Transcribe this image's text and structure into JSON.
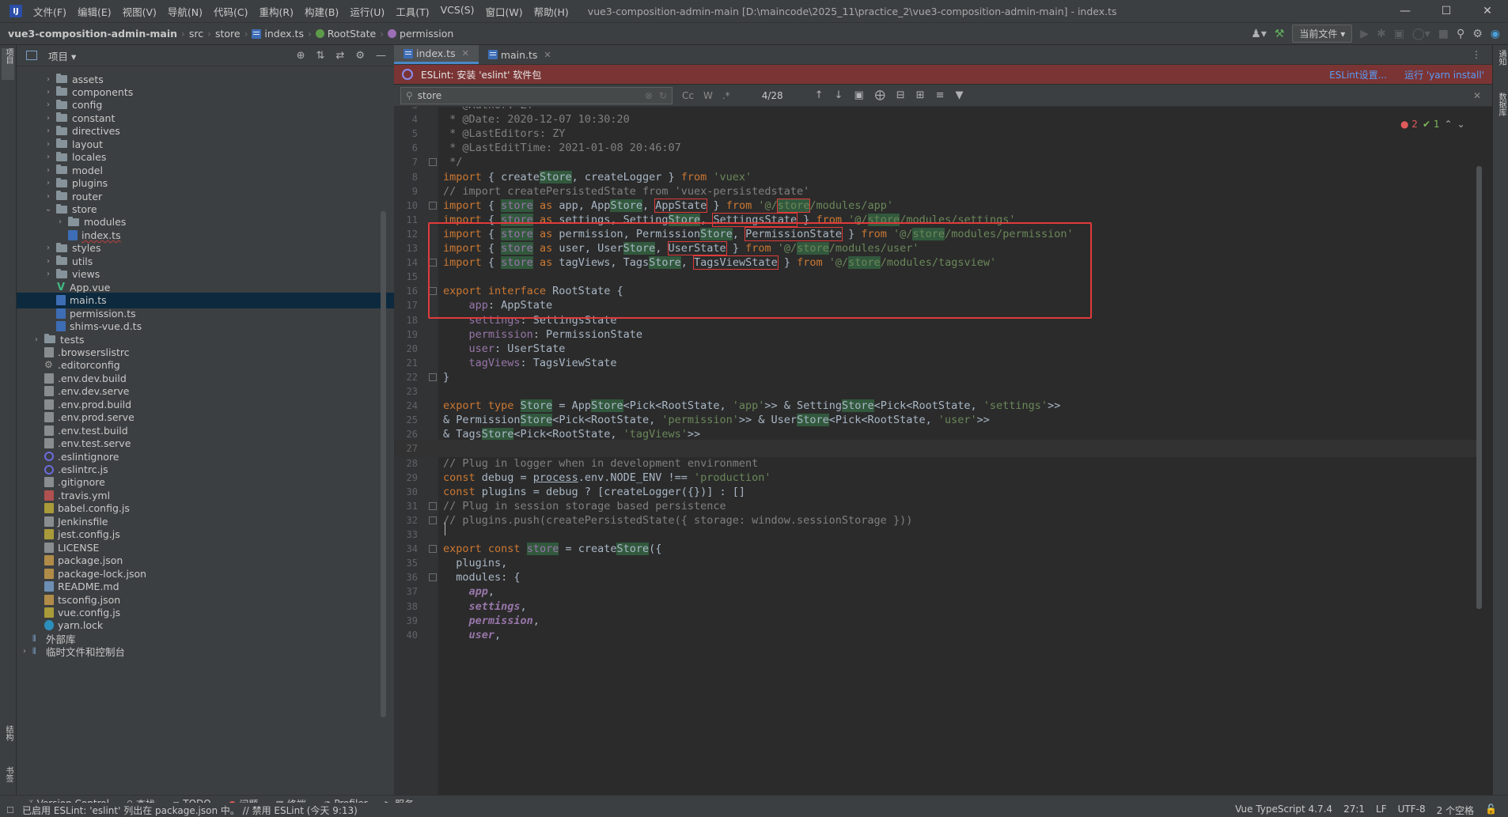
{
  "menubar": {
    "items": [
      "文件(F)",
      "编辑(E)",
      "视图(V)",
      "导航(N)",
      "代码(C)",
      "重构(R)",
      "构建(B)",
      "运行(U)",
      "工具(T)",
      "VCS(S)",
      "窗口(W)",
      "帮助(H)"
    ],
    "window_title": "vue3-composition-admin-main [D:\\maincode\\2025_11\\practice_2\\vue3-composition-admin-main] - index.ts"
  },
  "breadcrumb": [
    "vue3-composition-admin-main",
    "src",
    "store",
    "index.ts",
    "RootState",
    "permission"
  ],
  "toolbar": {
    "run_config": "当前文件"
  },
  "project_panel": {
    "title": "项目"
  },
  "tree": [
    {
      "label": "assets",
      "type": "folder",
      "depth": 1,
      "expanded": false
    },
    {
      "label": "components",
      "type": "folder",
      "depth": 1,
      "expanded": false
    },
    {
      "label": "config",
      "type": "folder",
      "depth": 1,
      "expanded": false
    },
    {
      "label": "constant",
      "type": "folder",
      "depth": 1,
      "expanded": false
    },
    {
      "label": "directives",
      "type": "folder",
      "depth": 1,
      "expanded": false
    },
    {
      "label": "layout",
      "type": "folder",
      "depth": 1,
      "expanded": false
    },
    {
      "label": "locales",
      "type": "folder",
      "depth": 1,
      "expanded": false
    },
    {
      "label": "model",
      "type": "folder",
      "depth": 1,
      "expanded": false
    },
    {
      "label": "plugins",
      "type": "folder",
      "depth": 1,
      "expanded": false
    },
    {
      "label": "router",
      "type": "folder",
      "depth": 1,
      "expanded": false
    },
    {
      "label": "store",
      "type": "folder",
      "depth": 1,
      "expanded": true
    },
    {
      "label": "modules",
      "type": "folder",
      "depth": 2,
      "expanded": false
    },
    {
      "label": "index.ts",
      "type": "ts",
      "depth": 2,
      "underline": true
    },
    {
      "label": "styles",
      "type": "folder",
      "depth": 1,
      "expanded": false
    },
    {
      "label": "utils",
      "type": "folder",
      "depth": 1,
      "expanded": false
    },
    {
      "label": "views",
      "type": "folder",
      "depth": 1,
      "expanded": false
    },
    {
      "label": "App.vue",
      "type": "vue",
      "depth": 1
    },
    {
      "label": "main.ts",
      "type": "ts",
      "depth": 1,
      "selected": true
    },
    {
      "label": "permission.ts",
      "type": "ts",
      "depth": 1
    },
    {
      "label": "shims-vue.d.ts",
      "type": "ts",
      "depth": 1
    },
    {
      "label": "tests",
      "type": "folder",
      "depth": 0,
      "expanded": false
    },
    {
      "label": ".browserslistrc",
      "type": "cfg",
      "depth": 0
    },
    {
      "label": ".editorconfig",
      "type": "gear",
      "depth": 0
    },
    {
      "label": ".env.dev.build",
      "type": "cfg",
      "depth": 0
    },
    {
      "label": ".env.dev.serve",
      "type": "cfg",
      "depth": 0
    },
    {
      "label": ".env.prod.build",
      "type": "cfg",
      "depth": 0
    },
    {
      "label": ".env.prod.serve",
      "type": "cfg",
      "depth": 0
    },
    {
      "label": ".env.test.build",
      "type": "cfg",
      "depth": 0
    },
    {
      "label": ".env.test.serve",
      "type": "cfg",
      "depth": 0
    },
    {
      "label": ".eslintignore",
      "type": "ring",
      "depth": 0
    },
    {
      "label": ".eslintrc.js",
      "type": "ring",
      "depth": 0
    },
    {
      "label": ".gitignore",
      "type": "cfg",
      "depth": 0
    },
    {
      "label": ".travis.yml",
      "type": "yml",
      "depth": 0
    },
    {
      "label": "babel.config.js",
      "type": "js",
      "depth": 0
    },
    {
      "label": "Jenkinsfile",
      "type": "cfg",
      "depth": 0
    },
    {
      "label": "jest.config.js",
      "type": "js",
      "depth": 0
    },
    {
      "label": "LICENSE",
      "type": "cfg",
      "depth": 0
    },
    {
      "label": "package.json",
      "type": "json",
      "depth": 0
    },
    {
      "label": "package-lock.json",
      "type": "json",
      "depth": 0
    },
    {
      "label": "README.md",
      "type": "md",
      "depth": 0
    },
    {
      "label": "tsconfig.json",
      "type": "json",
      "depth": 0
    },
    {
      "label": "vue.config.js",
      "type": "js",
      "depth": 0
    },
    {
      "label": "yarn.lock",
      "type": "yarn",
      "depth": 0
    },
    {
      "label": "外部库",
      "type": "lib",
      "depth": -1
    },
    {
      "label": "临时文件和控制台",
      "type": "lib",
      "depth": -1,
      "expandable": true
    }
  ],
  "editor_tabs": [
    {
      "label": "index.ts",
      "active": true
    },
    {
      "label": "main.ts",
      "active": false
    }
  ],
  "eslint_banner": {
    "text": "ESLint: 安装 'eslint' 软件包",
    "link_settings": "ESLint设置...",
    "link_install": "运行 'yarn install'"
  },
  "findbar": {
    "query": "store",
    "opt_case": "Cc",
    "opt_word": "W",
    "opt_regex": ".*",
    "count": "4/28"
  },
  "inspections": {
    "errors": "2",
    "warnings": "1"
  },
  "code_lines": [
    {
      "n": "3",
      "html": "<span class=\"com\"> * @Author: ZY</span>"
    },
    {
      "n": "4",
      "html": "<span class=\"com\"> * @Date: 2020-12-07 10:30:20</span>"
    },
    {
      "n": "5",
      "html": "<span class=\"com\"> * @LastEditors: ZY</span>"
    },
    {
      "n": "6",
      "html": "<span class=\"com\"> * @LastEditTime: 2021-01-08 20:46:07</span>"
    },
    {
      "n": "7",
      "html": "<span class=\"com\"> */</span>"
    },
    {
      "n": "8",
      "html": "<span class=\"kw\">import</span><span class=\"ident\"> { create</span><span class=\"ident hl\">Store</span><span class=\"ident\">, createLogger } </span><span class=\"kw\">from</span> <span class=\"str\">'vuex'</span>"
    },
    {
      "n": "9",
      "html": "<span class=\"com\">// import createPersistedState from 'vuex-persistedstate'</span>"
    },
    {
      "n": "10",
      "html": "<span class=\"kw\">import</span><span class=\"ident\"> { </span><span class=\"prop hl\">store</span> <span class=\"kw\">as</span><span class=\"ident\"> app, App</span><span class=\"ident hl\">Store</span><span class=\"ident\">, </span><span class=\"ident hl-box\">AppState</span><span class=\"ident\"> } </span><span class=\"kw\">from</span> <span class=\"str\">'@/</span><span class=\"str hl hl-box\">store</span><span class=\"str\">/modules/app'</span>"
    },
    {
      "n": "11",
      "html": "<span class=\"kw\">import</span><span class=\"ident\"> { </span><span class=\"prop hl\">store</span> <span class=\"kw\">as</span><span class=\"ident\"> settings, Setting</span><span class=\"ident hl\">Store</span><span class=\"ident\">, </span><span class=\"ident hl-box\">SettingsState</span><span class=\"ident\"> } </span><span class=\"kw\">from</span> <span class=\"str\">'@/</span><span class=\"str hl\">store</span><span class=\"str\">/modules/settings'</span>"
    },
    {
      "n": "12",
      "html": "<span class=\"kw\">import</span><span class=\"ident\"> { </span><span class=\"prop hl\">store</span> <span class=\"kw\">as</span><span class=\"ident\"> permission, Permission</span><span class=\"ident hl\">Store</span><span class=\"ident\">, </span><span class=\"ident hl-box\">PermissionState</span><span class=\"ident\"> } </span><span class=\"kw\">from</span> <span class=\"str\">'@/</span><span class=\"str hl\">store</span><span class=\"str\">/modules/permission'</span>"
    },
    {
      "n": "13",
      "html": "<span class=\"kw\">import</span><span class=\"ident\"> { </span><span class=\"prop hl\">store</span> <span class=\"kw\">as</span><span class=\"ident\"> user, User</span><span class=\"ident hl\">Store</span><span class=\"ident\">, </span><span class=\"ident hl-box\">UserState</span><span class=\"ident\"> } </span><span class=\"kw\">from</span> <span class=\"str\">'@/</span><span class=\"str hl\">store</span><span class=\"str\">/modules/user'</span>"
    },
    {
      "n": "14",
      "html": "<span class=\"kw\">import</span><span class=\"ident\"> { </span><span class=\"prop hl\">store</span> <span class=\"kw\">as</span><span class=\"ident\"> tagViews, Tags</span><span class=\"ident hl\">Store</span><span class=\"ident\">, </span><span class=\"ident hl-box\">TagsViewState</span><span class=\"ident\"> } </span><span class=\"kw\">from</span> <span class=\"str\">'@/</span><span class=\"str hl\">store</span><span class=\"str\">/modules/tagsview'</span>"
    },
    {
      "n": "15",
      "html": ""
    },
    {
      "n": "16",
      "html": "<span class=\"kw\">export interface</span><span class=\"ident\"> RootState {</span>"
    },
    {
      "n": "17",
      "html": "<span class=\"ident\">    </span><span class=\"prop\">app</span><span class=\"ident\">: AppState</span>"
    },
    {
      "n": "18",
      "html": "<span class=\"ident\">    </span><span class=\"prop\">settings</span><span class=\"ident\">: SettingsState</span>"
    },
    {
      "n": "19",
      "html": "<span class=\"ident\">    </span><span class=\"prop\">permission</span><span class=\"ident\">: PermissionState</span>"
    },
    {
      "n": "20",
      "html": "<span class=\"ident\">    </span><span class=\"prop\">user</span><span class=\"ident\">: UserState</span>"
    },
    {
      "n": "21",
      "html": "<span class=\"ident\">    </span><span class=\"prop\">tagViews</span><span class=\"ident\">: TagsViewState</span>"
    },
    {
      "n": "22",
      "html": "<span class=\"ident\">}</span>"
    },
    {
      "n": "23",
      "html": ""
    },
    {
      "n": "24",
      "html": "<span class=\"kw\">export type</span><span class=\"ident\"> </span><span class=\"ident hl\">Store</span><span class=\"ident\"> = App</span><span class=\"ident hl\">Store</span><span class=\"ident\">&lt;Pick&lt;RootState, </span><span class=\"str\">'app'</span><span class=\"ident\">&gt;&gt; &amp; Setting</span><span class=\"ident hl\">Store</span><span class=\"ident\">&lt;Pick&lt;RootState, </span><span class=\"str\">'settings'</span><span class=\"ident\">&gt;&gt;</span>"
    },
    {
      "n": "25",
      "html": "<span class=\"ident\">&amp; Permission</span><span class=\"ident hl\">Store</span><span class=\"ident\">&lt;Pick&lt;RootState, </span><span class=\"str\">'permission'</span><span class=\"ident\">&gt;&gt; &amp; User</span><span class=\"ident hl\">Store</span><span class=\"ident\">&lt;Pick&lt;RootState, </span><span class=\"str\">'user'</span><span class=\"ident\">&gt;&gt;</span>"
    },
    {
      "n": "26",
      "html": "<span class=\"ident\">&amp; Tags</span><span class=\"ident hl\">Store</span><span class=\"ident\">&lt;Pick&lt;RootState, </span><span class=\"str\">'tagViews'</span><span class=\"ident\">&gt;&gt;</span>"
    },
    {
      "n": "27",
      "html": "",
      "current": true
    },
    {
      "n": "28",
      "html": "<span class=\"com\">// Plug in logger when in development environment</span>"
    },
    {
      "n": "29",
      "html": "<span class=\"kw\">const</span><span class=\"ident\"> debug = </span><span class=\"ident\" style=\"text-decoration:underline\">process</span><span class=\"ident\">.env.NODE_ENV !== </span><span class=\"str\">'production'</span>"
    },
    {
      "n": "30",
      "html": "<span class=\"kw\">const</span><span class=\"ident\"> plugins = debug ? [createLogger({})] : []</span>"
    },
    {
      "n": "31",
      "html": "<span class=\"com\">// Plug in session storage based persistence</span>"
    },
    {
      "n": "32",
      "html": "<span class=\"com\">// plugins.push(createPersistedState({ storage: window.sessionStorage }))</span>"
    },
    {
      "n": "33",
      "html": ""
    },
    {
      "n": "34",
      "html": "<span class=\"kw\">export const</span><span class=\"ident\"> </span><span class=\"prop hl\">store</span><span class=\"ident\"> = create</span><span class=\"ident hl\">Store</span><span class=\"ident\">({</span>"
    },
    {
      "n": "35",
      "html": "<span class=\"ident\">  plugins,</span>"
    },
    {
      "n": "36",
      "html": "<span class=\"ident\">  modules: {</span>"
    },
    {
      "n": "37",
      "html": "<span class=\"ident\">    </span><span class=\"prop\" style=\"font-style:italic;font-weight:bold\">app</span><span class=\"ident\">,</span>"
    },
    {
      "n": "38",
      "html": "<span class=\"ident\">    </span><span class=\"prop\" style=\"font-style:italic;font-weight:bold\">settings</span><span class=\"ident\">,</span>"
    },
    {
      "n": "39",
      "html": "<span class=\"ident\">    </span><span class=\"prop\" style=\"font-style:italic;font-weight:bold\">permission</span><span class=\"ident\">,</span>"
    },
    {
      "n": "40",
      "html": "<span class=\"ident\">    </span><span class=\"prop\" style=\"font-style:italic;font-weight:bold\">user</span><span class=\"ident\">,</span>"
    }
  ],
  "bottom_tools": [
    "Version Control",
    "查找",
    "TODO",
    "问题",
    "终端",
    "Profiler",
    "服务"
  ],
  "statusbar": {
    "message": "已启用 ESLint: 'eslint' 列出在 package.json 中。 // 禁用 ESLint (今天 9:13)",
    "language": "Vue TypeScript 4.7.4",
    "position": "27:1",
    "line_sep": "LF",
    "encoding": "UTF-8",
    "indent": "2 个空格"
  },
  "colors": {
    "accent": "#4a88c7",
    "banner_error": "#7a3434",
    "annotation": "#e23a3a",
    "search_highlight": "#32593d"
  }
}
